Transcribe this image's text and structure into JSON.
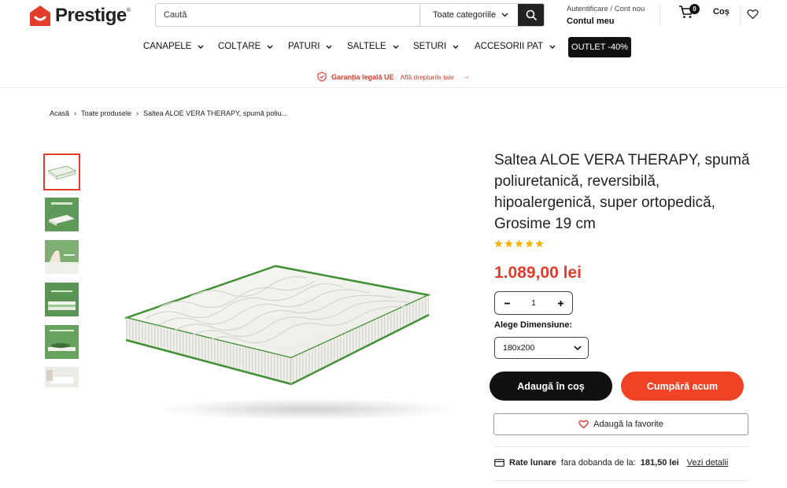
{
  "brand": {
    "name": "Prestige",
    "reg": "®",
    "color": "#e43c2c"
  },
  "search": {
    "placeholder": "Caută",
    "category": "Toate categoriile"
  },
  "account": {
    "top": "Autentificare / Cont nou",
    "main": "Contul meu"
  },
  "cart": {
    "count": "0",
    "label": "Coș"
  },
  "nav": {
    "items": [
      {
        "label": "CANAPELE"
      },
      {
        "label": "COLȚARE"
      },
      {
        "label": "PATURI"
      },
      {
        "label": "SALTELE"
      },
      {
        "label": "SETURI"
      },
      {
        "label": "ACCESORII PAT"
      }
    ],
    "outlet": "OUTLET -40%"
  },
  "guarantee": {
    "title": "Garanția legală UE",
    "sub": "Află drepturile tale",
    "arrow": "→"
  },
  "breadcrumb": [
    "Acasă",
    "Toate produsele",
    "Saltea ALOE VERA THERAPY, spumă poliu..."
  ],
  "product": {
    "title": "Saltea ALOE VERA THERAPY, spumă poliuretanică, reversibilă, hipoalergenică, super ortopedică, Grosime 19 cm",
    "rating": 5,
    "price": "1.089,00 lei",
    "quantity": "1",
    "size_label": "Alege Dimensiune:",
    "size_value": "180x200",
    "add_to_cart": "Adaugă în coș",
    "buy_now": "Cumpără acum",
    "add_favorite": "Adaugă la favorite",
    "rates": {
      "label": "Rate lunare",
      "text": "fara dobanda de la:",
      "amount": "181,50 lei",
      "link": "Vezi detalii"
    }
  },
  "colors": {
    "accent": "#e43c2c",
    "buy": "#f04224",
    "star": "#f5b301",
    "mattress_edge": "#4a9a3d"
  },
  "icons": [
    "search-icon",
    "cart-icon",
    "heart-icon",
    "shield-icon",
    "chevron-down-icon",
    "star-icon",
    "card-icon"
  ]
}
